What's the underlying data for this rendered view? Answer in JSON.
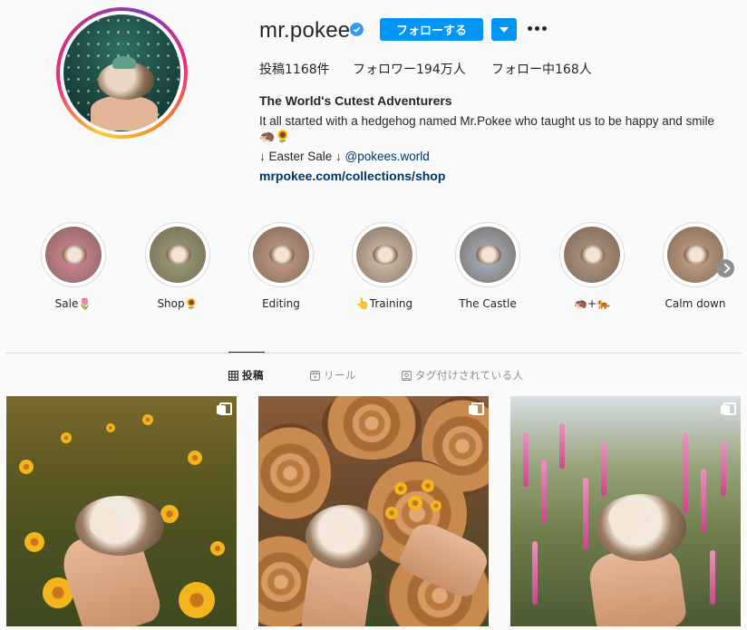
{
  "profile": {
    "username": "mr.pokee",
    "follow_label": "フォローする",
    "stats": {
      "posts": "投稿1168件",
      "followers": "フォロワー194万人",
      "following": "フォロー中168人"
    },
    "bio": {
      "name": "The World's Cutest Adventurers",
      "text": "It all started with a hedgehog named Mr.Pokee who taught us to be happy and smile",
      "emoji_line": "🦔🌻",
      "easter_prefix": "↓ Easter Sale ↓ ",
      "easter_mention": "@pokees.world",
      "link": "mrpokee.com/collections/shop"
    }
  },
  "highlights": [
    {
      "label": "Sale🌷",
      "color": "#d98a9a"
    },
    {
      "label": "Shop🌻",
      "color": "#9aa27a"
    },
    {
      "label": "Editing",
      "color": "#c8a08a"
    },
    {
      "label": "👆Training",
      "color": "#d9c7b4"
    },
    {
      "label": "The Castle",
      "color": "#a7b8c9"
    },
    {
      "label": "🦔+🐅",
      "color": "#b49a86"
    },
    {
      "label": "Calm down",
      "color": "#c9a588"
    }
  ],
  "tabs": [
    {
      "label": "投稿",
      "icon": "grid-icon",
      "active": true
    },
    {
      "label": "リール",
      "icon": "reels-icon",
      "active": false
    },
    {
      "label": "タグ付けされている人",
      "icon": "tagged-icon",
      "active": false
    }
  ],
  "posts": [
    {
      "scene": "hedgehog in hand among yellow flowers",
      "multi": true
    },
    {
      "scene": "hedgehog in hand on stacked logs with yellow bouquet",
      "multi": true
    },
    {
      "scene": "hedgehog in hand among pink fireweed",
      "multi": true
    }
  ],
  "colors": {
    "accent": "#0095f6",
    "link": "#00376b",
    "verified": "#3897f0"
  }
}
